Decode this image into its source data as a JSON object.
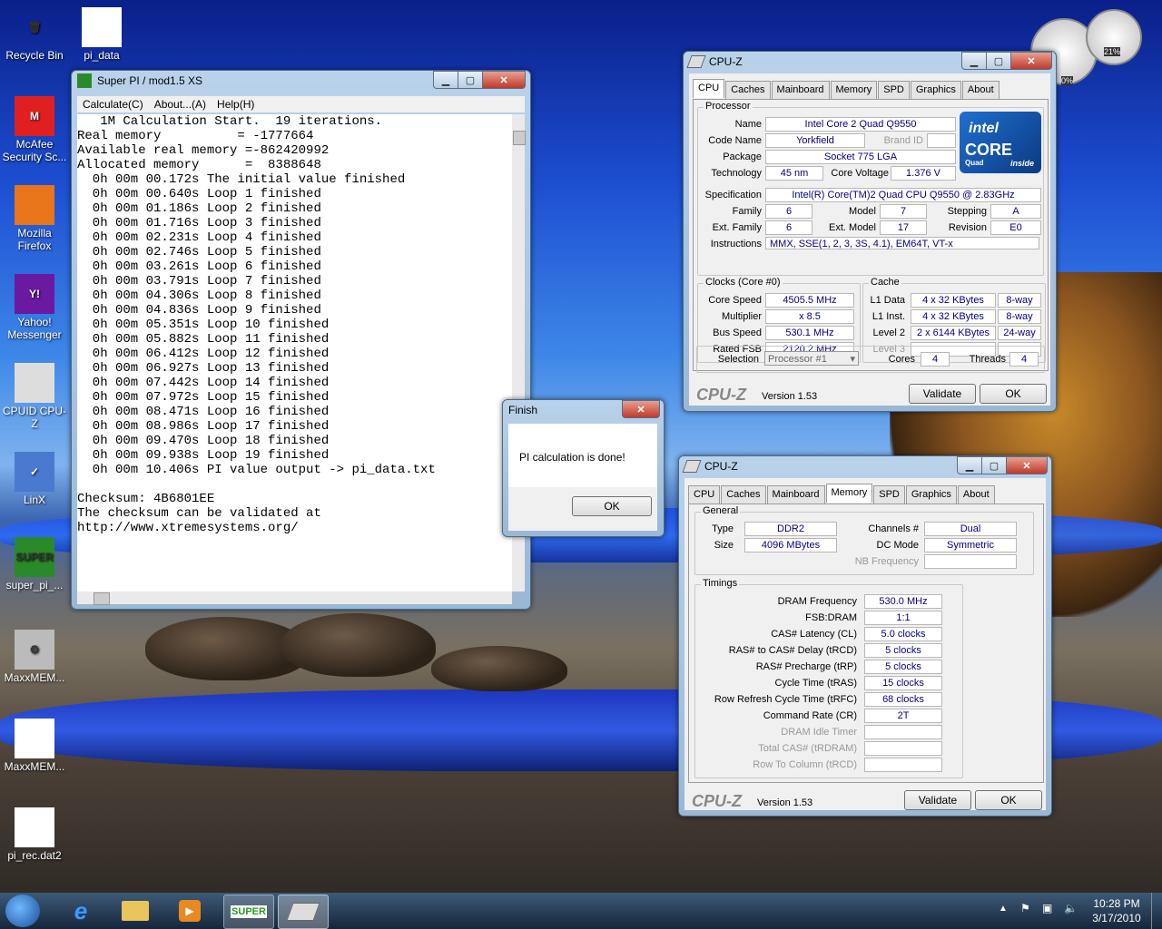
{
  "desktop": {
    "icons": [
      {
        "label": "Recycle Bin",
        "glyph": "🗑"
      },
      {
        "label": "pi_data",
        "glyph": ""
      },
      {
        "label": "McAfee Security Sc...",
        "glyph": "M"
      },
      {
        "label": "Mozilla Firefox",
        "glyph": ""
      },
      {
        "label": "Yahoo! Messenger",
        "glyph": "Y!"
      },
      {
        "label": "CPUID CPU-Z",
        "glyph": ""
      },
      {
        "label": "LinX",
        "glyph": "✓"
      },
      {
        "label": "super_pi_...",
        "glyph": "SUPER"
      },
      {
        "label": "MaxxMEM...",
        "glyph": "⚙"
      },
      {
        "label": "MaxxMEM...",
        "glyph": ""
      },
      {
        "label": "pi_rec.dat2",
        "glyph": ""
      }
    ],
    "gadget": {
      "cpu_percent": "0%",
      "mem_percent": "21%"
    }
  },
  "superpi": {
    "title": "Super PI / mod1.5 XS",
    "menu": [
      "Calculate(C)",
      "About...(A)",
      "Help(H)"
    ],
    "lines": [
      "   1M Calculation Start.  19 iterations.",
      "Real memory          = -1777664",
      "Available real memory =-862420992",
      "Allocated memory      =  8388648",
      "  0h 00m 00.172s The initial value finished",
      "  0h 00m 00.640s Loop 1 finished",
      "  0h 00m 01.186s Loop 2 finished",
      "  0h 00m 01.716s Loop 3 finished",
      "  0h 00m 02.231s Loop 4 finished",
      "  0h 00m 02.746s Loop 5 finished",
      "  0h 00m 03.261s Loop 6 finished",
      "  0h 00m 03.791s Loop 7 finished",
      "  0h 00m 04.306s Loop 8 finished",
      "  0h 00m 04.836s Loop 9 finished",
      "  0h 00m 05.351s Loop 10 finished",
      "  0h 00m 05.882s Loop 11 finished",
      "  0h 00m 06.412s Loop 12 finished",
      "  0h 00m 06.927s Loop 13 finished",
      "  0h 00m 07.442s Loop 14 finished",
      "  0h 00m 07.972s Loop 15 finished",
      "  0h 00m 08.471s Loop 16 finished",
      "  0h 00m 08.986s Loop 17 finished",
      "  0h 00m 09.470s Loop 18 finished",
      "  0h 00m 09.938s Loop 19 finished",
      "  0h 00m 10.406s PI value output -> pi_data.txt",
      "",
      "Checksum: 4B6801EE",
      "The checksum can be validated at",
      "http://www.xtremesystems.org/"
    ]
  },
  "finish_dialog": {
    "title": "Finish",
    "message": "PI calculation is done!",
    "ok": "OK"
  },
  "cpuz_cpu": {
    "title": "CPU-Z",
    "tabs": [
      "CPU",
      "Caches",
      "Mainboard",
      "Memory",
      "SPD",
      "Graphics",
      "About"
    ],
    "processor_label": "Processor",
    "name_label": "Name",
    "name": "Intel Core 2 Quad Q9550",
    "codename_label": "Code Name",
    "codename": "Yorkfield",
    "brandid_label": "Brand ID",
    "package_label": "Package",
    "package": "Socket 775 LGA",
    "technology_label": "Technology",
    "technology": "45 nm",
    "corevoltage_label": "Core Voltage",
    "corevoltage": "1.376 V",
    "spec_label": "Specification",
    "spec": "Intel(R) Core(TM)2 Quad CPU    Q9550  @ 2.83GHz",
    "family_label": "Family",
    "family": "6",
    "model_label": "Model",
    "model": "7",
    "stepping_label": "Stepping",
    "stepping": "A",
    "extfamily_label": "Ext. Family",
    "extfamily": "6",
    "extmodel_label": "Ext. Model",
    "extmodel": "17",
    "revision_label": "Revision",
    "revision": "E0",
    "instructions_label": "Instructions",
    "instructions": "MMX, SSE(1, 2, 3, 3S, 4.1), EM64T, VT-x",
    "clocks_label": "Clocks (Core #0)",
    "corespeed_label": "Core Speed",
    "corespeed": "4505.5 MHz",
    "multiplier_label": "Multiplier",
    "multiplier": "x 8.5",
    "busspeed_label": "Bus Speed",
    "busspeed": "530.1 MHz",
    "ratedfsb_label": "Rated FSB",
    "ratedfsb": "2120.2 MHz",
    "cache_label": "Cache",
    "l1d_label": "L1 Data",
    "l1d": "4 x 32 KBytes",
    "l1d_way": "8-way",
    "l1i_label": "L1 Inst.",
    "l1i": "4 x 32 KBytes",
    "l1i_way": "8-way",
    "l2_label": "Level 2",
    "l2": "2 x 6144 KBytes",
    "l2_way": "24-way",
    "l3_label": "Level 3",
    "selection_label": "Selection",
    "selection": "Processor #1",
    "cores_label": "Cores",
    "cores": "4",
    "threads_label": "Threads",
    "threads": "4",
    "logo": "CPU-Z",
    "version": "Version 1.53",
    "validate": "Validate",
    "ok": "OK",
    "intel_logo": {
      "brand": "intel",
      "core": "CORE",
      "quad": "Quad",
      "inside": "inside"
    }
  },
  "cpuz_mem": {
    "title": "CPU-Z",
    "tabs": [
      "CPU",
      "Caches",
      "Mainboard",
      "Memory",
      "SPD",
      "Graphics",
      "About"
    ],
    "general_label": "General",
    "type_label": "Type",
    "type": "DDR2",
    "size_label": "Size",
    "size": "4096 MBytes",
    "channels_label": "Channels #",
    "channels": "Dual",
    "dcmode_label": "DC Mode",
    "dcmode": "Symmetric",
    "nbfreq_label": "NB Frequency",
    "timings_label": "Timings",
    "timings": [
      {
        "label": "DRAM Frequency",
        "value": "530.0 MHz"
      },
      {
        "label": "FSB:DRAM",
        "value": "1:1"
      },
      {
        "label": "CAS# Latency (CL)",
        "value": "5.0 clocks"
      },
      {
        "label": "RAS# to CAS# Delay (tRCD)",
        "value": "5 clocks"
      },
      {
        "label": "RAS# Precharge (tRP)",
        "value": "5 clocks"
      },
      {
        "label": "Cycle Time (tRAS)",
        "value": "15 clocks"
      },
      {
        "label": "Row Refresh Cycle Time (tRFC)",
        "value": "68 clocks"
      },
      {
        "label": "Command Rate (CR)",
        "value": "2T"
      },
      {
        "label": "DRAM Idle Timer",
        "value": ""
      },
      {
        "label": "Total CAS# (tRDRAM)",
        "value": ""
      },
      {
        "label": "Row To Column (tRCD)",
        "value": ""
      }
    ],
    "logo": "CPU-Z",
    "version": "Version 1.53",
    "validate": "Validate",
    "ok": "OK"
  },
  "taskbar": {
    "time": "10:28 PM",
    "date": "3/17/2010",
    "pinned_superpi_label": "SUPER"
  }
}
